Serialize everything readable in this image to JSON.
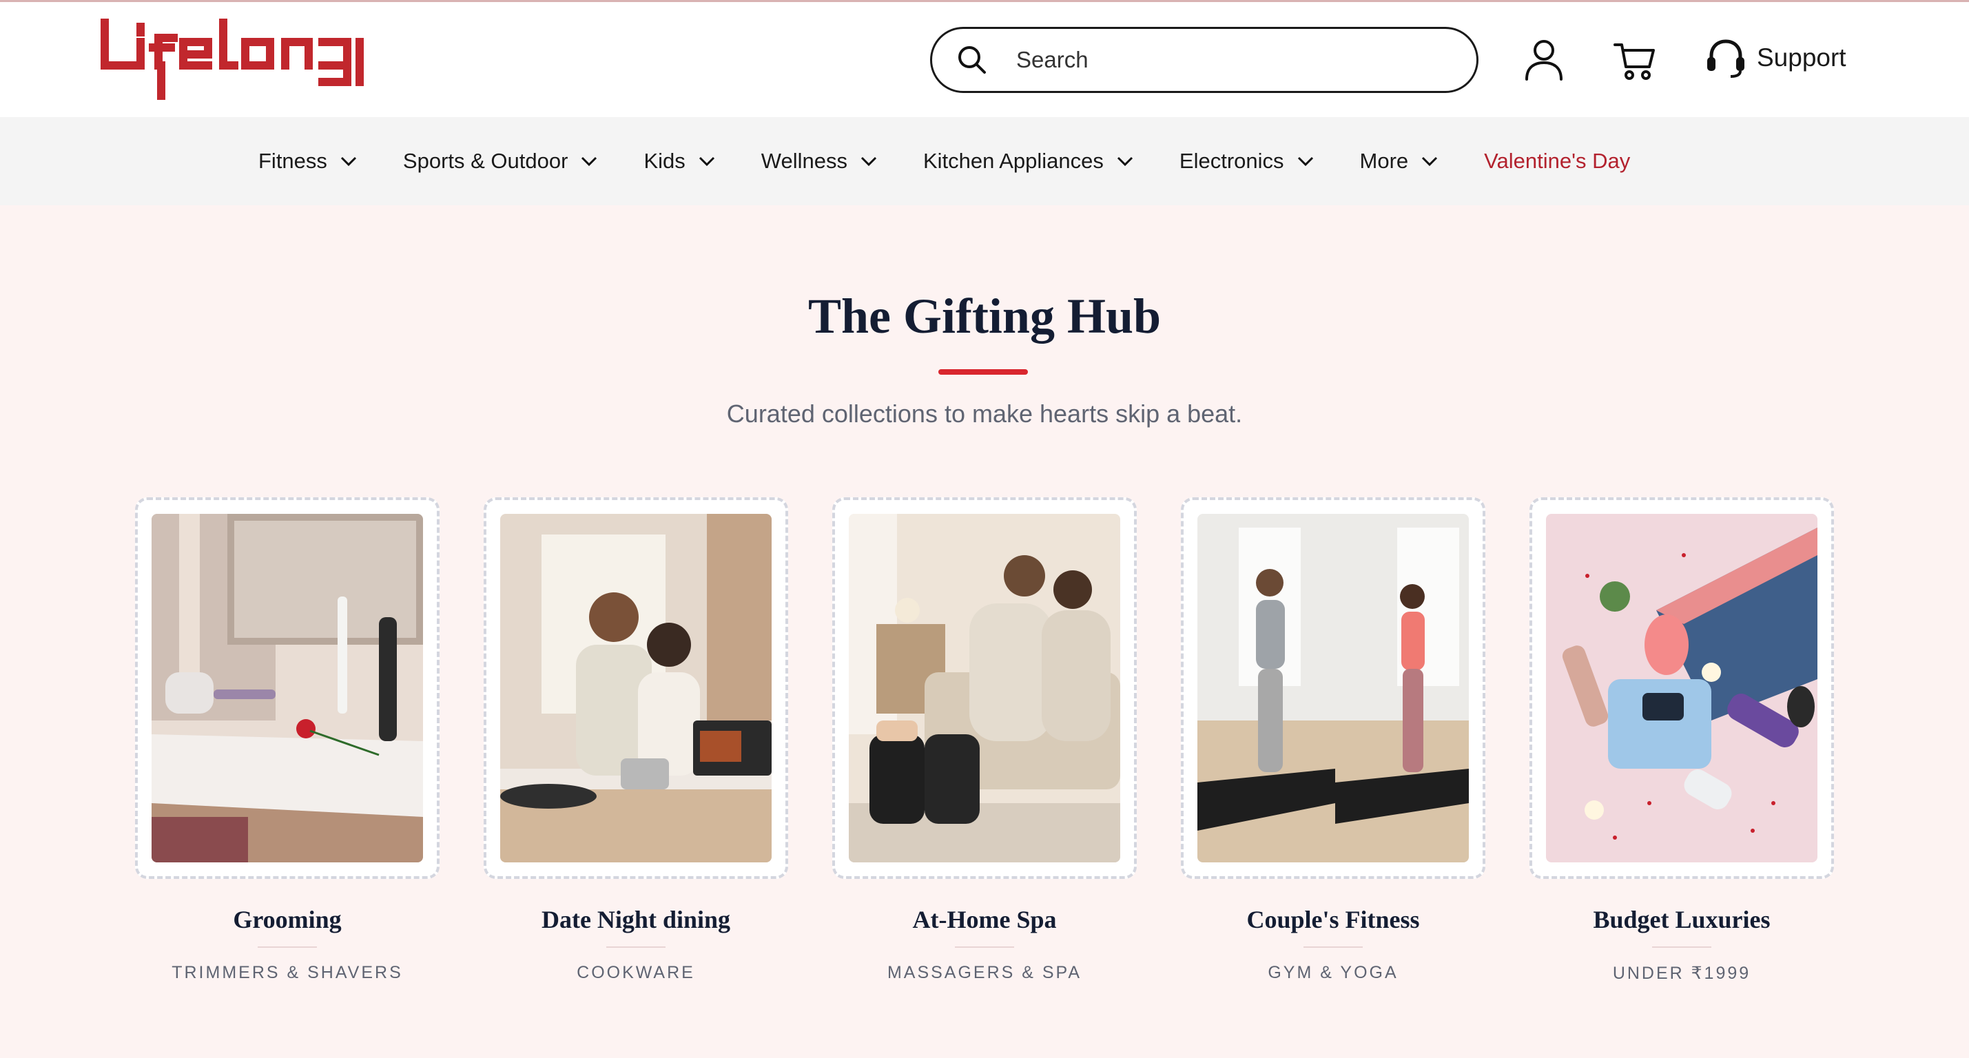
{
  "brand": {
    "name": "Lifelong",
    "color": "#c1272d"
  },
  "header": {
    "search_placeholder": "Search",
    "support_label": "Support",
    "icons": [
      "search-icon",
      "user-icon",
      "cart-icon",
      "headset-icon"
    ]
  },
  "nav": {
    "items": [
      {
        "label": "Fitness"
      },
      {
        "label": "Sports & Outdoor"
      },
      {
        "label": "Kids"
      },
      {
        "label": "Wellness"
      },
      {
        "label": "Kitchen Appliances"
      },
      {
        "label": "Electronics"
      },
      {
        "label": "More"
      }
    ],
    "highlight": "Valentine's Day",
    "highlight_color": "#b3222e"
  },
  "main": {
    "title": "The Gifting Hub",
    "subtitle": "Curated collections to make hearts skip a beat.",
    "accent_color": "#d9262e",
    "cards": [
      {
        "name": "Grooming",
        "sub": "TRIMMERS & SHAVERS"
      },
      {
        "name": "Date Night dining",
        "sub": "COOKWARE"
      },
      {
        "name": "At-Home Spa",
        "sub": "MASSAGERS & SPA"
      },
      {
        "name": "Couple's Fitness",
        "sub": "GYM & YOGA"
      },
      {
        "name": "Budget Luxuries",
        "sub": "UNDER ₹1999"
      }
    ]
  }
}
